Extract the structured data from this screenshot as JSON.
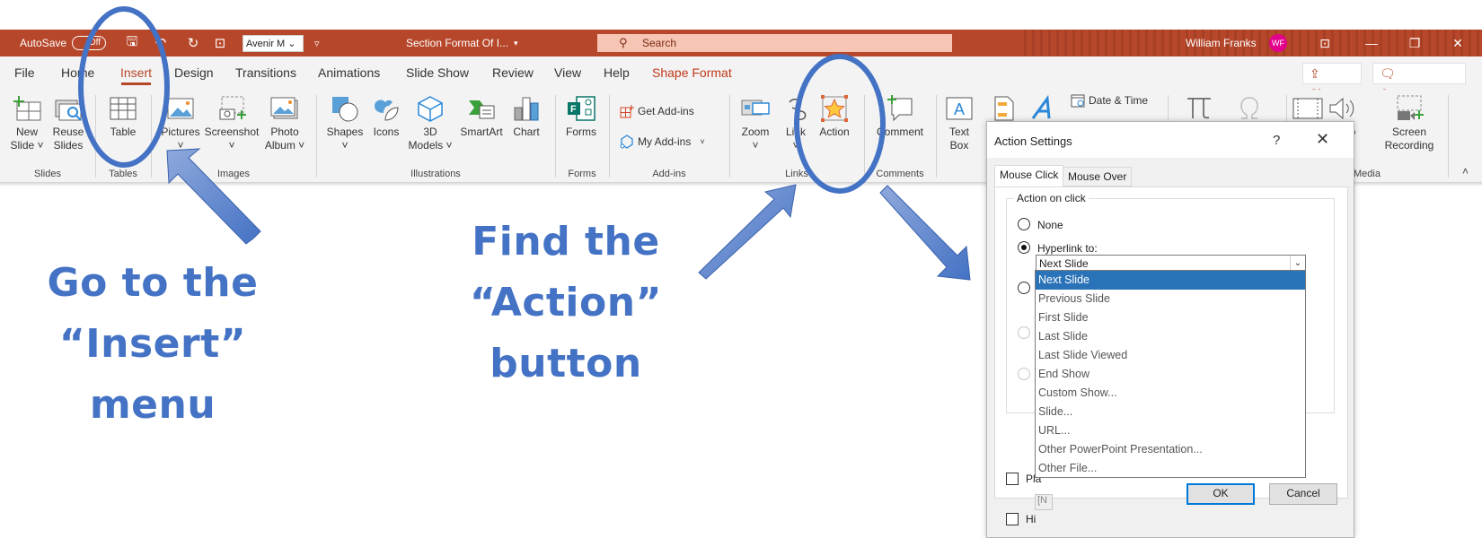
{
  "titlebar": {
    "autosave_label": "AutoSave",
    "autosave_state": "Off",
    "font_box": "Avenir M",
    "doc_title": "Section Format Of I...",
    "doc_title_caret": "▾",
    "search_placeholder": "Search",
    "user_name": "William Franks",
    "user_initials": "WF",
    "window_buttons": [
      "ribbon-display",
      "minimize",
      "restore",
      "close"
    ]
  },
  "tabs": [
    {
      "label": "File"
    },
    {
      "label": "Home"
    },
    {
      "label": "Insert",
      "active": true
    },
    {
      "label": "Design"
    },
    {
      "label": "Transitions"
    },
    {
      "label": "Animations"
    },
    {
      "label": "Slide Show"
    },
    {
      "label": "Review"
    },
    {
      "label": "View"
    },
    {
      "label": "Help"
    },
    {
      "label": "Shape Format",
      "contextual": true
    }
  ],
  "tab_actions": {
    "share": "Share",
    "comments": "Comments"
  },
  "ribbon": {
    "groups": {
      "slides": "Slides",
      "tables": "Tables",
      "images": "Images",
      "illustrations": "Illustrations",
      "forms": "Forms",
      "addins": "Add-ins",
      "links": "Links",
      "comments": "Comments",
      "media": "Media"
    },
    "buttons": {
      "new_slide": "New\nSlide ˅",
      "new_slide_1": "New",
      "new_slide_2": "Slide ˅",
      "reuse_1": "Reuse",
      "reuse_2": "Slides",
      "table": "Table",
      "pictures_1": "Pictures",
      "pictures_2": "˅",
      "screenshot_1": "Screenshot",
      "screenshot_2": "˅",
      "photo_1": "Photo",
      "photo_2": "Album ˅",
      "shapes_1": "Shapes",
      "shapes_2": "˅",
      "icons": "Icons",
      "models_1": "3D",
      "models_2": "Models ˅",
      "smartart": "SmartArt",
      "chart": "Chart",
      "forms": "Forms",
      "get_addins": "Get Add-ins",
      "my_addins": "My Add-ins",
      "zoom_1": "Zoom",
      "zoom_2": "˅",
      "link_1": "Link",
      "link_2": "˅",
      "action": "Action",
      "comment": "Comment",
      "textbox_1": "Text",
      "textbox_2": "Box",
      "date_time": "Date & Time",
      "audio_1": "Audio",
      "audio_2": "˅",
      "screen_rec_1": "Screen",
      "screen_rec_2": "Recording"
    }
  },
  "instructions": {
    "step1": [
      "Go to the",
      "“Insert”",
      "menu"
    ],
    "step2": [
      "Find the",
      "“Action”",
      "button"
    ]
  },
  "dialog": {
    "title": "Action Settings",
    "help": "?",
    "close": "✕",
    "tabs": [
      "Mouse Click",
      "Mouse Over"
    ],
    "active_tab": "Mouse Click",
    "group_label": "Action on click",
    "options": {
      "none": "None",
      "hyperlink": "Hyperlink to:",
      "selected": "hyperlink"
    },
    "hyperlink_value": "Next Slide",
    "dropdown_items": [
      "Next Slide",
      "Previous Slide",
      "First Slide",
      "Last Slide",
      "Last Slide Viewed",
      "End Show",
      "Custom Show...",
      "Slide...",
      "URL...",
      "Other PowerPoint Presentation...",
      "Other File..."
    ],
    "dropdown_selected_index": 0,
    "play_sound_label": "Pla",
    "sound_value": "[N",
    "highlight_label": "Hi",
    "ok": "OK",
    "cancel": "Cancel"
  },
  "colors": {
    "titlebar": "#b7472a",
    "accent": "#b7472a",
    "annotation": "#4472c4",
    "selection": "#2b73b9",
    "avatar": "#e3008c"
  }
}
